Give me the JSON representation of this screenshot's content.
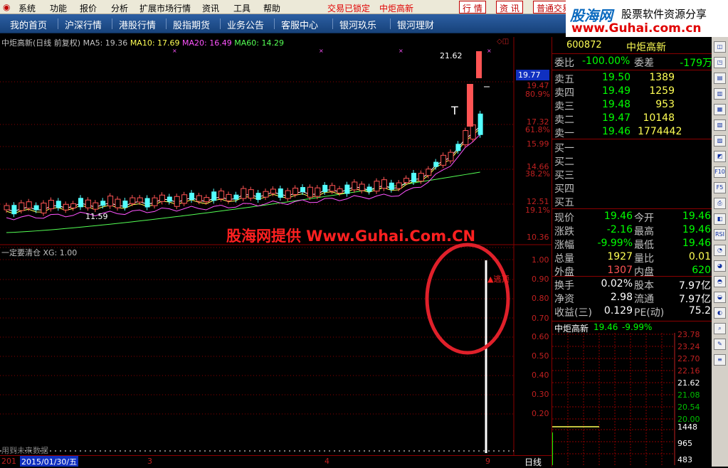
{
  "menu": {
    "items": [
      "系统",
      "功能",
      "报价",
      "分析",
      "扩展市场行情",
      "资讯",
      "工具",
      "帮助"
    ],
    "status1": "交易已锁定",
    "status2": "中炬高新",
    "btn_quote": "行 情",
    "btn_info": "资 讯",
    "btn_trade": "普通交易"
  },
  "nav": {
    "items": [
      "我的首页",
      "沪深行情",
      "港股行情",
      "股指期货",
      "业务公告",
      "客服中心",
      "银河玖乐",
      "银河理财"
    ]
  },
  "logo": {
    "brand": "股海网",
    "slogan": "股票软件资源分享",
    "url": "www.Guhai.com.cn"
  },
  "chart": {
    "title": "中炬高新(日线 前复权)",
    "ma5": "MA5: 19.36",
    "ma10": "MA10: 17.69",
    "ma20": "MA20: 16.49",
    "ma60": "MA60: 14.29",
    "high_label": "21.62",
    "low_label": "11.59",
    "t_label": "T",
    "price_axis": [
      "21.62",
      "19.47",
      "17.32",
      "15.99",
      "14.66",
      "12.51",
      "10.36"
    ],
    "pct_axis": [
      "80.9%",
      "61.8%",
      "38.2%",
      "19.1%"
    ],
    "price_tag": "19.77"
  },
  "indicator": {
    "title": "一定要清仓 XG: 1.00",
    "axis": [
      "1.00",
      "0.90",
      "0.80",
      "0.70",
      "0.60",
      "0.50",
      "0.40",
      "0.30",
      "0.20"
    ],
    "signal": "▲逃顶"
  },
  "watermark": "股海网提供 Www.Guhai.Com.CN",
  "bottom": {
    "date": "2015/01/30/五",
    "m3": "3",
    "m4": "4",
    "m9": "9",
    "left_label": "201",
    "period": "日线",
    "note": "用到未来数据"
  },
  "quote": {
    "code": "600872",
    "name": "中炬高新",
    "weibi": {
      "label": "委比",
      "value": "-100.00%",
      "label2": "委差",
      "value2": "-179万"
    },
    "sells": [
      {
        "label": "卖五",
        "price": "19.50",
        "qty": "1389"
      },
      {
        "label": "卖四",
        "price": "19.49",
        "qty": "1259"
      },
      {
        "label": "卖三",
        "price": "19.48",
        "qty": "953"
      },
      {
        "label": "卖二",
        "price": "19.47",
        "qty": "10148"
      },
      {
        "label": "卖一",
        "price": "19.46",
        "qty": "1774442"
      }
    ],
    "buys": [
      {
        "label": "买一"
      },
      {
        "label": "买二"
      },
      {
        "label": "买三"
      },
      {
        "label": "买四"
      },
      {
        "label": "买五"
      }
    ],
    "stats": [
      {
        "k": "现价",
        "v": "19.46",
        "k2": "今开",
        "v2": "19.46"
      },
      {
        "k": "涨跌",
        "v": "-2.16",
        "k2": "最高",
        "v2": "19.46"
      },
      {
        "k": "涨幅",
        "v": "-9.99%",
        "k2": "最低",
        "v2": "19.46"
      },
      {
        "k": "总量",
        "v": "1927",
        "k2": "量比",
        "v2": "0.01"
      },
      {
        "k": "外盘",
        "v": "1307",
        "k2": "内盘",
        "v2": "620"
      },
      {
        "k": "换手",
        "v": "0.02%",
        "k2": "股本",
        "v2": "7.97亿"
      },
      {
        "k": "净资",
        "v": "2.98",
        "k2": "流通",
        "v2": "7.97亿"
      },
      {
        "k": "收益(三)",
        "v": "0.129",
        "k2": "PE(动)",
        "v2": "75.2"
      }
    ],
    "mini": {
      "title": "中炬高新",
      "price": "19.46",
      "pct": "-9.99%",
      "axis": [
        "23.78",
        "23.24",
        "22.70",
        "22.16",
        "21.62",
        "21.08",
        "20.54",
        "20.00"
      ],
      "vol_axis": [
        "1448",
        "965",
        "483"
      ]
    }
  }
}
